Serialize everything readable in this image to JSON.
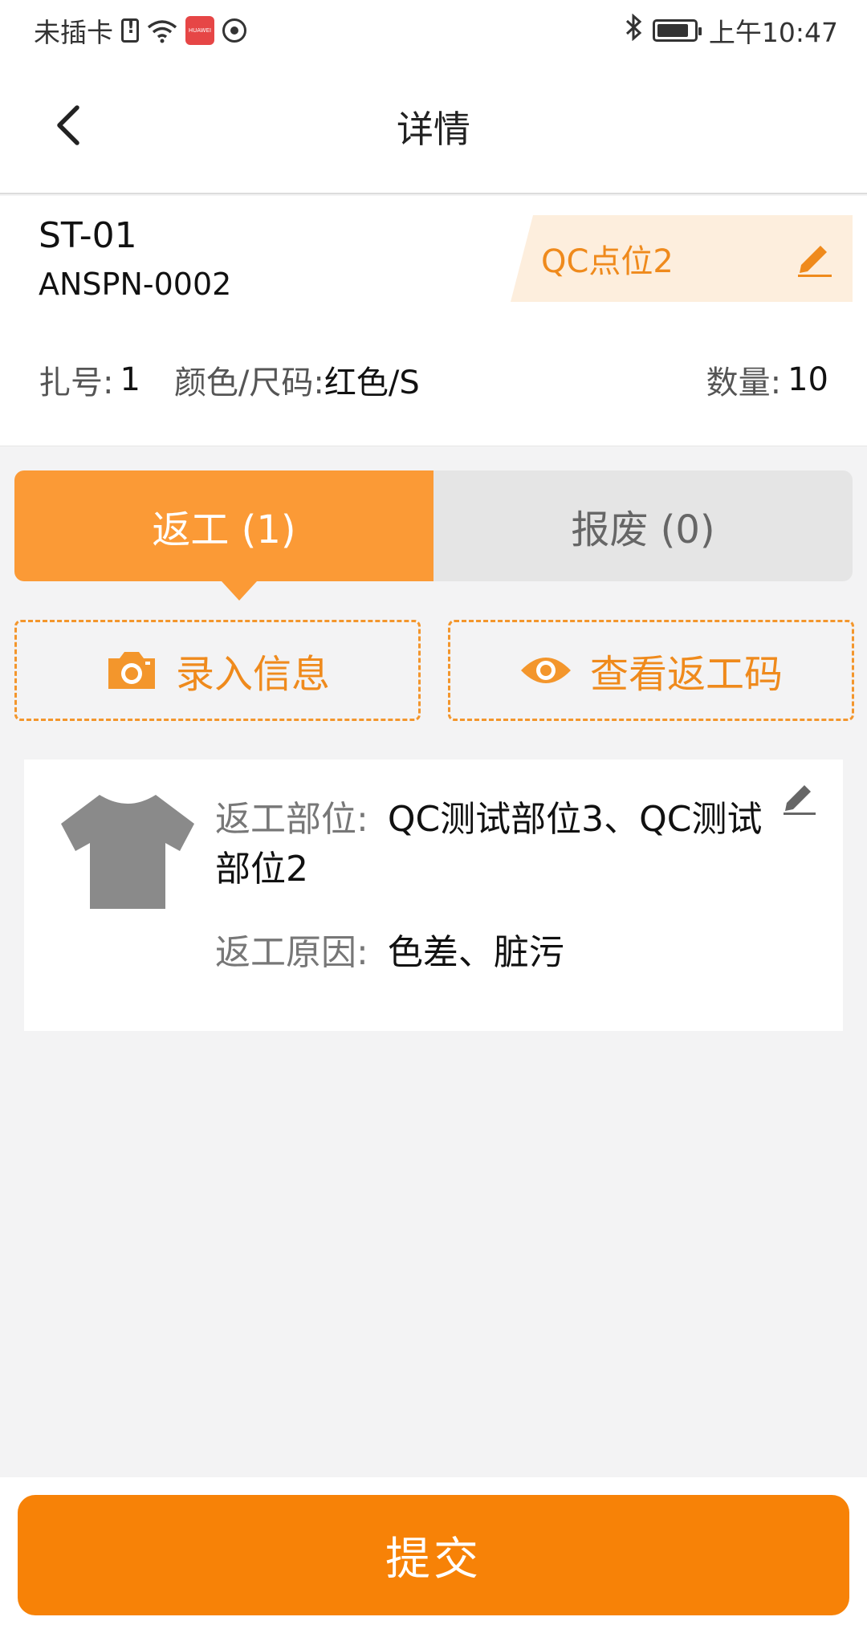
{
  "status_bar": {
    "carrier": "未插卡",
    "time": "上午10:47",
    "icons": [
      "sim-alert-icon",
      "wifi-icon",
      "huawei-app-icon",
      "hotspot-icon",
      "bluetooth-icon",
      "battery-icon"
    ]
  },
  "nav": {
    "title": "详情",
    "back_icon": "chevron-left-icon"
  },
  "info": {
    "style_no": "ST-01",
    "order_no": "ANSPN-0002",
    "qc_point": "QC点位2",
    "bundle_label": "扎号:",
    "bundle_value": "1",
    "color_size_label": "颜色/尺码:",
    "color_size_value": "红色/S",
    "qty_label": "数量:",
    "qty_value": "10"
  },
  "tabs": [
    {
      "label": "返工 (1)",
      "active": true
    },
    {
      "label": "报废 (0)",
      "active": false
    }
  ],
  "actions": {
    "entry_label": "录入信息",
    "entry_icon": "camera-icon",
    "view_label": "查看返工码",
    "view_icon": "eye-icon"
  },
  "rework_item": {
    "image_icon": "tshirt-icon",
    "part_label": "返工部位:",
    "part_value": "QC测试部位3、QC测试部位2",
    "reason_label": "返工原因:",
    "reason_value": "色差、脏污"
  },
  "submit_label": "提交",
  "colors": {
    "accent": "#f78207",
    "tab_active": "#fb9a36",
    "tag_bg": "#fdeedd",
    "tag_text": "#ef8a1c"
  }
}
